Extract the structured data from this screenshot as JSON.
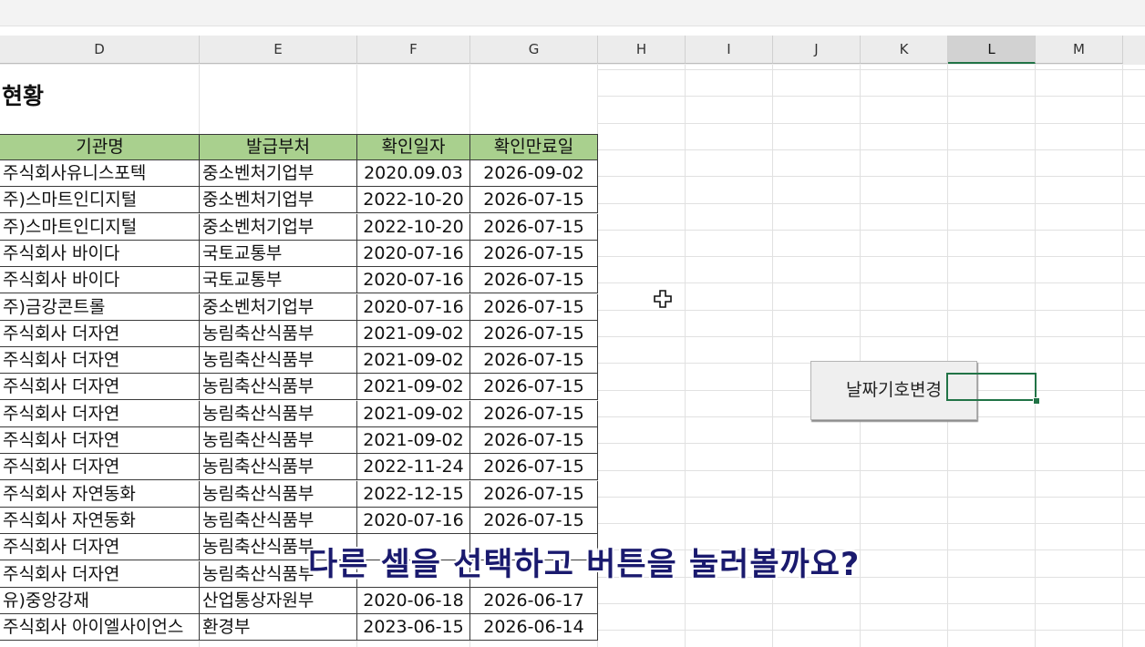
{
  "columns": [
    "D",
    "E",
    "F",
    "G",
    "H",
    "I",
    "J",
    "K",
    "L",
    "M"
  ],
  "selected_column": "L",
  "sheet": {
    "title": "현황",
    "headers": [
      "기관명",
      "발급부처",
      "확인일자",
      "확인만료일"
    ],
    "rows": [
      [
        "주식회사유니스포텍",
        "중소벤처기업부",
        "2020.09.03",
        "2026-09-02"
      ],
      [
        "주)스마트인디지털",
        "중소벤처기업부",
        "2022-10-20",
        "2026-07-15"
      ],
      [
        "주)스마트인디지털",
        "중소벤처기업부",
        "2022-10-20",
        "2026-07-15"
      ],
      [
        "주식회사 바이다",
        "국토교통부",
        "2020-07-16",
        "2026-07-15"
      ],
      [
        "주식회사 바이다",
        "국토교통부",
        "2020-07-16",
        "2026-07-15"
      ],
      [
        "주)금강콘트롤",
        "중소벤처기업부",
        "2020-07-16",
        "2026-07-15"
      ],
      [
        "주식회사 더자연",
        "농림축산식품부",
        "2021-09-02",
        "2026-07-15"
      ],
      [
        "주식회사 더자연",
        "농림축산식품부",
        "2021-09-02",
        "2026-07-15"
      ],
      [
        "주식회사 더자연",
        "농림축산식품부",
        "2021-09-02",
        "2026-07-15"
      ],
      [
        "주식회사 더자연",
        "농림축산식품부",
        "2021-09-02",
        "2026-07-15"
      ],
      [
        "주식회사 더자연",
        "농림축산식품부",
        "2021-09-02",
        "2026-07-15"
      ],
      [
        "주식회사 더자연",
        "농림축산식품부",
        "2022-11-24",
        "2026-07-15"
      ],
      [
        "주식회사 자연동화",
        "농림축산식품부",
        "2022-12-15",
        "2026-07-15"
      ],
      [
        "주식회사 자연동화",
        "농림축산식품부",
        "2020-07-16",
        "2026-07-15"
      ],
      [
        "주식회사 더자연",
        "농림축산식품부",
        "",
        ""
      ],
      [
        "주식회사 더자연",
        "농림축산식품부",
        "",
        ""
      ],
      [
        "유)중앙강재",
        "산업통상자원부",
        "2020-06-18",
        "2026-06-17"
      ],
      [
        "주식회사 아이엘사이언스",
        "환경부",
        "2023-06-15",
        "2026-06-14"
      ]
    ]
  },
  "macro_button": {
    "label": "날짜기호변경"
  },
  "subtitle": "다른 셀을 선택하고 버튼을 눌러볼까요?",
  "colors": {
    "header_fill": "#a9d08e",
    "selection": "#217346",
    "subtitle": "#1a1a6e"
  }
}
